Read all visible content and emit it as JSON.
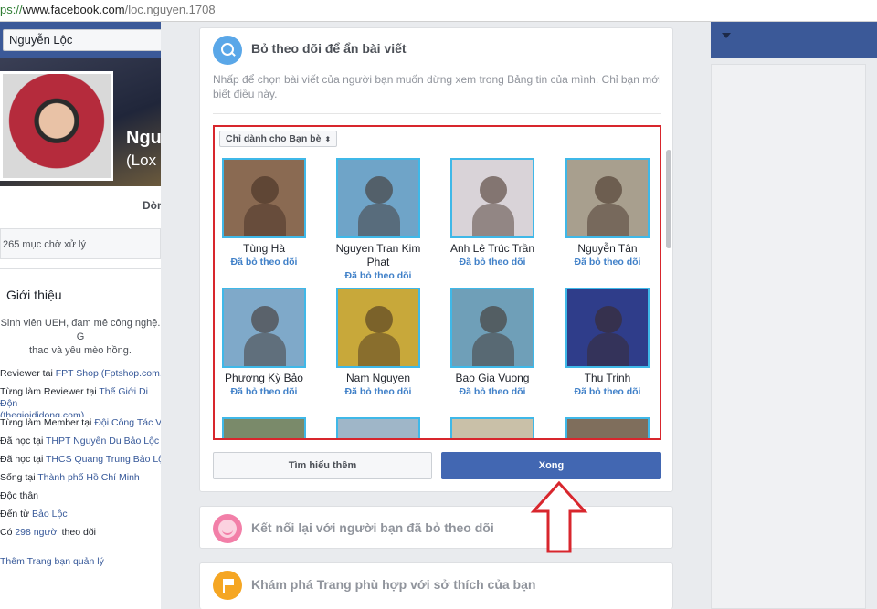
{
  "browser": {
    "url_proto": "ps://",
    "url_host": "www.facebook.com",
    "url_path": "/loc.nguyen.1708"
  },
  "topbar": {
    "name": "Nguyễn Lộc"
  },
  "profile": {
    "name": "Ngu",
    "nickname": "(Lox",
    "tab_partial": "Dòn",
    "pending": "265 mục chờ xử lý",
    "intro_title": "Giới thiệu",
    "bio_line1": "Sinh viên UEH, đam mê công nghệ. G",
    "bio_line2": "thao và yêu mèo hồng.",
    "details": [
      {
        "prefix": "Reviewer tại ",
        "link": "FPT Shop (Fptshop.com.v",
        "suffix": ""
      },
      {
        "prefix": "Từng làm Reviewer tại ",
        "link": "Thế Giới Di Độn",
        "suffix": "",
        "line2": "(thegioididong.com)"
      },
      {
        "prefix": "Từng làm Member tại ",
        "link": "Đội Công Tác Vi",
        "suffix": ""
      },
      {
        "prefix": "Đã học tại ",
        "link": "THPT Nguyễn Du Bảo Lộc",
        "suffix": ""
      },
      {
        "prefix": "Đã học tại ",
        "link": "THCS Quang Trung Bảo Lộc",
        "suffix": ""
      },
      {
        "prefix": "Sống tại ",
        "link": "Thành phố Hồ Chí Minh",
        "suffix": ""
      },
      {
        "prefix": "Độc thân",
        "link": "",
        "suffix": ""
      },
      {
        "prefix": "Đến từ ",
        "link": "Bảo Lộc",
        "suffix": ""
      },
      {
        "prefix": "Có ",
        "link": "298 người",
        "suffix": " theo dõi"
      }
    ],
    "manage_pages": "Thêm Trang bạn quản lý"
  },
  "unfollow_card": {
    "title": "Bỏ theo dõi để ẩn bài viết",
    "description": "Nhấp để chọn bài viết của người bạn muốn dừng xem trong Bảng tin của mình. Chỉ bạn mới biết điều này.",
    "privacy_option": "Chỉ dành cho Bạn bè",
    "privacy_arrow": "⬍",
    "friends": [
      {
        "name": "Tùng Hà",
        "status": "Đã bỏ theo dõi",
        "bg": "#8a6a52"
      },
      {
        "name": "Nguyen Tran Kim Phat",
        "status": "Đã bỏ theo dõi",
        "bg": "#6fa4c8"
      },
      {
        "name": "Anh Lê Trúc Trần",
        "status": "Đã bỏ theo dõi",
        "bg": "#d9d3d8"
      },
      {
        "name": "Nguyễn Tân",
        "status": "Đã bỏ theo dõi",
        "bg": "#a89f8e"
      },
      {
        "name": "Phương Kỳ Bảo",
        "status": "Đã bỏ theo dõi",
        "bg": "#7fa9c9"
      },
      {
        "name": "Nam Nguyen",
        "status": "Đã bỏ theo dõi",
        "bg": "#c8a83a"
      },
      {
        "name": "Bao Gia Vuong",
        "status": "Đã bỏ theo dõi",
        "bg": "#6f9fb8"
      },
      {
        "name": "Thu Trinh",
        "status": "Đã bỏ theo dõi",
        "bg": "#2f3d8a"
      }
    ],
    "learn_more": "Tìm hiểu thêm",
    "done": "Xong"
  },
  "reconnect_card": {
    "title": "Kết nối lại với người bạn đã bỏ theo dõi"
  },
  "discover_card": {
    "title": "Khám phá Trang phù hợp với sở thích của bạn"
  },
  "colors": {
    "facebook_blue": "#3b5998",
    "button_blue": "#4267b2",
    "highlight_red": "#d8262d",
    "status_blue": "#4080c8"
  }
}
